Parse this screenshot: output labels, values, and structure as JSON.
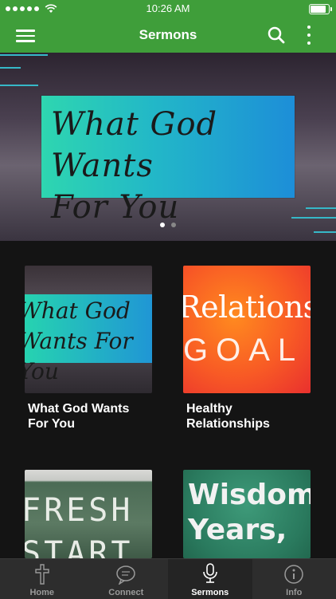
{
  "status": {
    "time": "10:26 AM"
  },
  "nav": {
    "title": "Sermons"
  },
  "hero": {
    "art_text_line1": "What God Wants",
    "art_text_line2": "For You",
    "page_count": 2,
    "active_page": 1
  },
  "sermons": [
    {
      "title": "What God Wants For You",
      "art": "What God Wants For You"
    },
    {
      "title": "Healthy Relationships",
      "art_line1": "Relationship",
      "art_line2": "GOAL"
    },
    {
      "title": "",
      "art_line1": "FRESH",
      "art_line2": "START"
    },
    {
      "title": "",
      "art_line1": "Wisdom,",
      "art_line2": "Years,"
    }
  ],
  "tabs": [
    {
      "label": "Home",
      "icon": "cross-icon"
    },
    {
      "label": "Connect",
      "icon": "chat-icon"
    },
    {
      "label": "Sermons",
      "icon": "microphone-icon"
    },
    {
      "label": "Info",
      "icon": "info-icon"
    }
  ],
  "colors": {
    "nav_green": "#3f9e3a",
    "background": "#141414",
    "tabbar": "#2d2d2d"
  }
}
